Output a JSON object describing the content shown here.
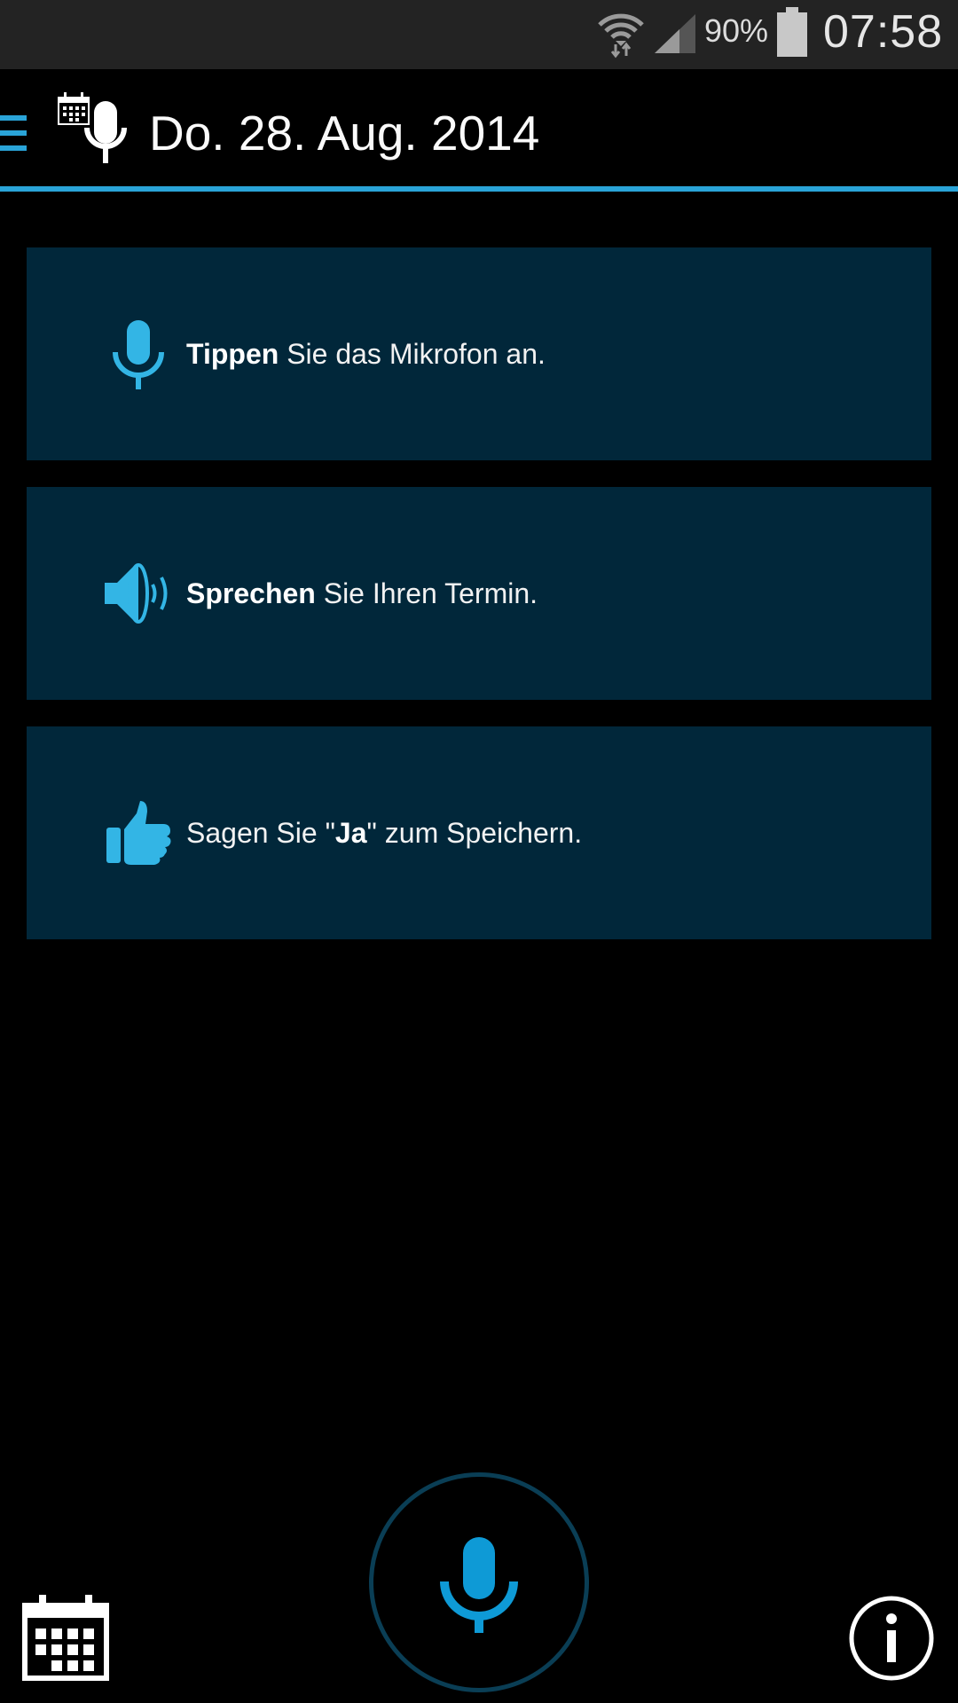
{
  "status_bar": {
    "battery_percent": "90%",
    "time": "07:58",
    "icons": [
      "wifi-icon",
      "cell-signal-icon",
      "battery-icon"
    ]
  },
  "action_bar": {
    "title": "Do. 28. Aug. 2014",
    "accent_color": "#2aa4d8"
  },
  "instructions": [
    {
      "icon": "microphone-icon",
      "bold": "Tippen",
      "pre": "",
      "post": " Sie das Mikrofon an."
    },
    {
      "icon": "speaker-icon",
      "bold": "Sprechen",
      "pre": "",
      "post": " Sie Ihren Termin."
    },
    {
      "icon": "thumbs-up-icon",
      "bold": "Ja",
      "pre": "Sagen Sie \"",
      "post": "\" zum Speichern."
    }
  ],
  "colors": {
    "card_background": "#01273a",
    "icon_blue": "#33b5e5",
    "mic_ring": "#0a3e55",
    "mic_button": "#0e9ad6"
  },
  "bottom_bar": {
    "left_icon": "calendar-icon",
    "center_icon": "microphone-icon",
    "right_icon": "info-icon"
  }
}
